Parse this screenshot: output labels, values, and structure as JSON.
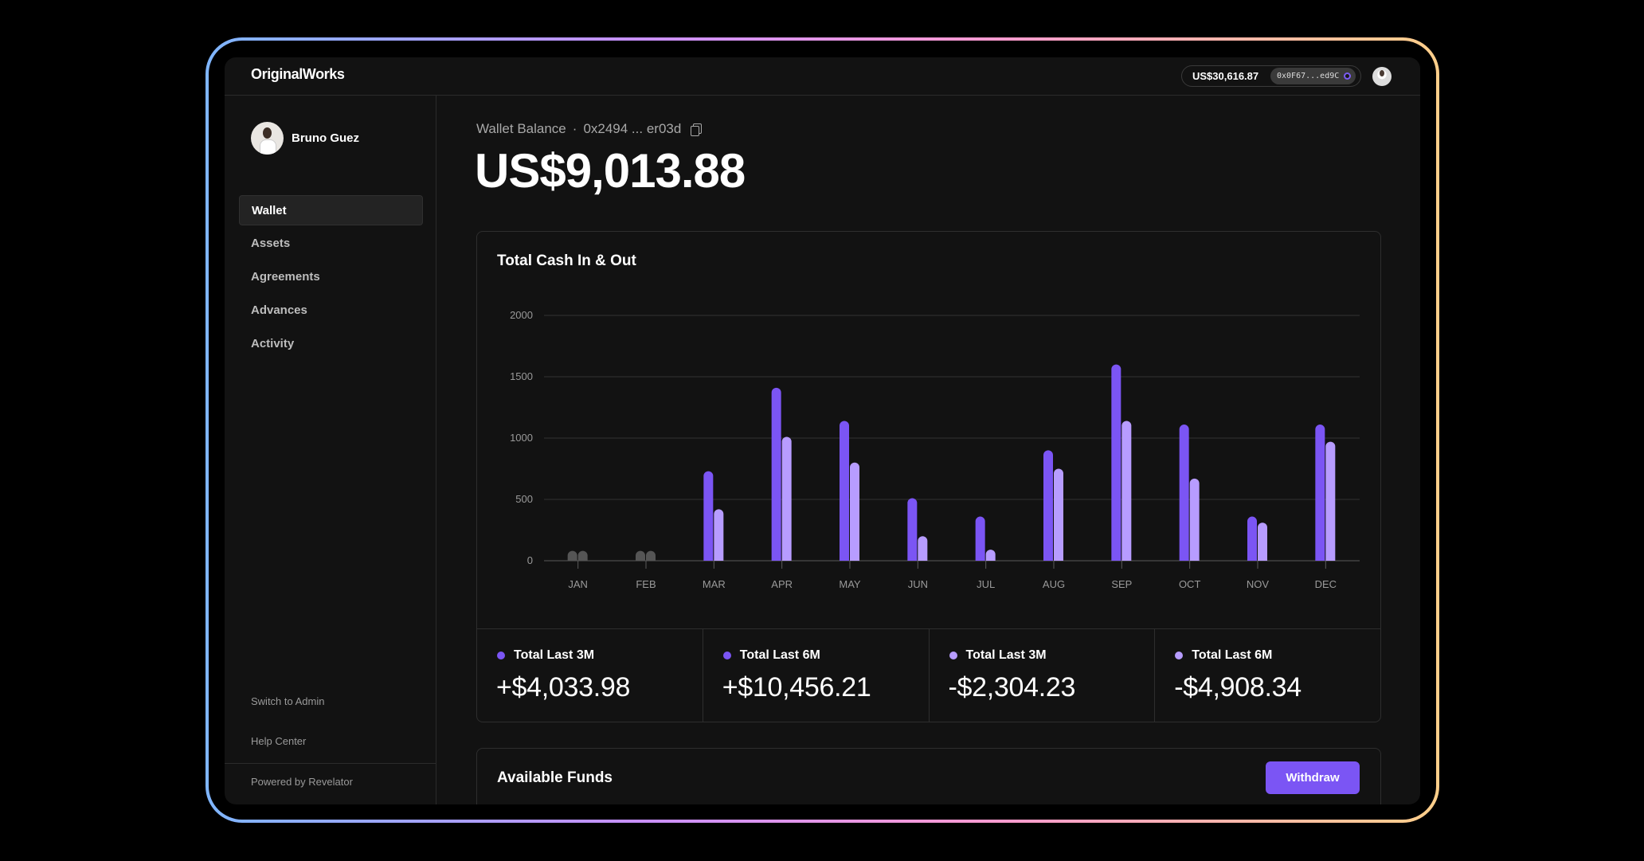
{
  "app": {
    "logo": "OriginalWorks"
  },
  "header": {
    "wallet_total": "US$30,616.87",
    "wallet_address": "0x0F67...ed9C"
  },
  "sidebar": {
    "user_name": "Bruno Guez",
    "items": [
      {
        "label": "Wallet",
        "active": true
      },
      {
        "label": "Assets",
        "active": false
      },
      {
        "label": "Agreements",
        "active": false
      },
      {
        "label": "Advances",
        "active": false
      },
      {
        "label": "Activity",
        "active": false
      }
    ],
    "switch_admin": "Switch to Admin",
    "help_center": "Help Center",
    "powered_by": "Powered by Revelator"
  },
  "main": {
    "balance_label": "Wallet Balance",
    "balance_address": "0x2494 ... er03d",
    "balance_amount": "US$9,013.88",
    "chart_title": "Total Cash In & Out",
    "stats": [
      {
        "label": "Total Last 3M",
        "value": "+$4,033.98",
        "color": "#7b55f4"
      },
      {
        "label": "Total Last 6M",
        "value": "+$10,456.21",
        "color": "#7b55f4"
      },
      {
        "label": "Total Last 3M",
        "value": "-$2,304.23",
        "color": "#b79cff"
      },
      {
        "label": "Total Last 6M",
        "value": "-$4,908.34",
        "color": "#b79cff"
      }
    ],
    "funds_title": "Available Funds",
    "withdraw_label": "Withdraw"
  },
  "chart_data": {
    "type": "bar",
    "title": "Total Cash In & Out",
    "categories": [
      "JAN",
      "FEB",
      "MAR",
      "APR",
      "MAY",
      "JUN",
      "JUL",
      "AUG",
      "SEP",
      "OCT",
      "NOV",
      "DEC"
    ],
    "series": [
      {
        "values": [
          80,
          80,
          730,
          1410,
          1140,
          510,
          360,
          900,
          1600,
          1110,
          360,
          1110
        ],
        "color": "#7b55f4"
      },
      {
        "values": [
          80,
          80,
          420,
          1010,
          800,
          200,
          90,
          750,
          1140,
          670,
          310,
          970
        ],
        "color": "#b79cff"
      }
    ],
    "inactive_categories": [
      "JAN",
      "FEB"
    ],
    "inactive_color": "#555555",
    "yticks": [
      0,
      500,
      1000,
      1500,
      2000
    ],
    "ylim": [
      0,
      2000
    ],
    "grid": true
  }
}
